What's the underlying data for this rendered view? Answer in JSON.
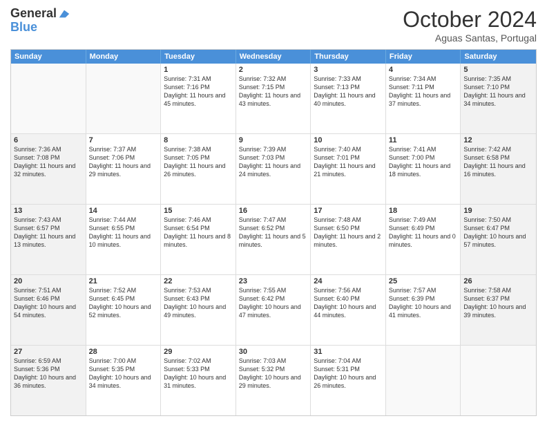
{
  "header": {
    "logo_line1": "General",
    "logo_line2": "Blue",
    "month_title": "October 2024",
    "location": "Aguas Santas, Portugal"
  },
  "days_of_week": [
    "Sunday",
    "Monday",
    "Tuesday",
    "Wednesday",
    "Thursday",
    "Friday",
    "Saturday"
  ],
  "rows": [
    [
      {
        "day": "",
        "text": "",
        "shade": false,
        "empty": true
      },
      {
        "day": "",
        "text": "",
        "shade": false,
        "empty": true
      },
      {
        "day": "1",
        "text": "Sunrise: 7:31 AM\nSunset: 7:16 PM\nDaylight: 11 hours and 45 minutes.",
        "shade": false,
        "empty": false
      },
      {
        "day": "2",
        "text": "Sunrise: 7:32 AM\nSunset: 7:15 PM\nDaylight: 11 hours and 43 minutes.",
        "shade": false,
        "empty": false
      },
      {
        "day": "3",
        "text": "Sunrise: 7:33 AM\nSunset: 7:13 PM\nDaylight: 11 hours and 40 minutes.",
        "shade": false,
        "empty": false
      },
      {
        "day": "4",
        "text": "Sunrise: 7:34 AM\nSunset: 7:11 PM\nDaylight: 11 hours and 37 minutes.",
        "shade": false,
        "empty": false
      },
      {
        "day": "5",
        "text": "Sunrise: 7:35 AM\nSunset: 7:10 PM\nDaylight: 11 hours and 34 minutes.",
        "shade": true,
        "empty": false
      }
    ],
    [
      {
        "day": "6",
        "text": "Sunrise: 7:36 AM\nSunset: 7:08 PM\nDaylight: 11 hours and 32 minutes.",
        "shade": true,
        "empty": false
      },
      {
        "day": "7",
        "text": "Sunrise: 7:37 AM\nSunset: 7:06 PM\nDaylight: 11 hours and 29 minutes.",
        "shade": false,
        "empty": false
      },
      {
        "day": "8",
        "text": "Sunrise: 7:38 AM\nSunset: 7:05 PM\nDaylight: 11 hours and 26 minutes.",
        "shade": false,
        "empty": false
      },
      {
        "day": "9",
        "text": "Sunrise: 7:39 AM\nSunset: 7:03 PM\nDaylight: 11 hours and 24 minutes.",
        "shade": false,
        "empty": false
      },
      {
        "day": "10",
        "text": "Sunrise: 7:40 AM\nSunset: 7:01 PM\nDaylight: 11 hours and 21 minutes.",
        "shade": false,
        "empty": false
      },
      {
        "day": "11",
        "text": "Sunrise: 7:41 AM\nSunset: 7:00 PM\nDaylight: 11 hours and 18 minutes.",
        "shade": false,
        "empty": false
      },
      {
        "day": "12",
        "text": "Sunrise: 7:42 AM\nSunset: 6:58 PM\nDaylight: 11 hours and 16 minutes.",
        "shade": true,
        "empty": false
      }
    ],
    [
      {
        "day": "13",
        "text": "Sunrise: 7:43 AM\nSunset: 6:57 PM\nDaylight: 11 hours and 13 minutes.",
        "shade": true,
        "empty": false
      },
      {
        "day": "14",
        "text": "Sunrise: 7:44 AM\nSunset: 6:55 PM\nDaylight: 11 hours and 10 minutes.",
        "shade": false,
        "empty": false
      },
      {
        "day": "15",
        "text": "Sunrise: 7:46 AM\nSunset: 6:54 PM\nDaylight: 11 hours and 8 minutes.",
        "shade": false,
        "empty": false
      },
      {
        "day": "16",
        "text": "Sunrise: 7:47 AM\nSunset: 6:52 PM\nDaylight: 11 hours and 5 minutes.",
        "shade": false,
        "empty": false
      },
      {
        "day": "17",
        "text": "Sunrise: 7:48 AM\nSunset: 6:50 PM\nDaylight: 11 hours and 2 minutes.",
        "shade": false,
        "empty": false
      },
      {
        "day": "18",
        "text": "Sunrise: 7:49 AM\nSunset: 6:49 PM\nDaylight: 11 hours and 0 minutes.",
        "shade": false,
        "empty": false
      },
      {
        "day": "19",
        "text": "Sunrise: 7:50 AM\nSunset: 6:47 PM\nDaylight: 10 hours and 57 minutes.",
        "shade": true,
        "empty": false
      }
    ],
    [
      {
        "day": "20",
        "text": "Sunrise: 7:51 AM\nSunset: 6:46 PM\nDaylight: 10 hours and 54 minutes.",
        "shade": true,
        "empty": false
      },
      {
        "day": "21",
        "text": "Sunrise: 7:52 AM\nSunset: 6:45 PM\nDaylight: 10 hours and 52 minutes.",
        "shade": false,
        "empty": false
      },
      {
        "day": "22",
        "text": "Sunrise: 7:53 AM\nSunset: 6:43 PM\nDaylight: 10 hours and 49 minutes.",
        "shade": false,
        "empty": false
      },
      {
        "day": "23",
        "text": "Sunrise: 7:55 AM\nSunset: 6:42 PM\nDaylight: 10 hours and 47 minutes.",
        "shade": false,
        "empty": false
      },
      {
        "day": "24",
        "text": "Sunrise: 7:56 AM\nSunset: 6:40 PM\nDaylight: 10 hours and 44 minutes.",
        "shade": false,
        "empty": false
      },
      {
        "day": "25",
        "text": "Sunrise: 7:57 AM\nSunset: 6:39 PM\nDaylight: 10 hours and 41 minutes.",
        "shade": false,
        "empty": false
      },
      {
        "day": "26",
        "text": "Sunrise: 7:58 AM\nSunset: 6:37 PM\nDaylight: 10 hours and 39 minutes.",
        "shade": true,
        "empty": false
      }
    ],
    [
      {
        "day": "27",
        "text": "Sunrise: 6:59 AM\nSunset: 5:36 PM\nDaylight: 10 hours and 36 minutes.",
        "shade": true,
        "empty": false
      },
      {
        "day": "28",
        "text": "Sunrise: 7:00 AM\nSunset: 5:35 PM\nDaylight: 10 hours and 34 minutes.",
        "shade": false,
        "empty": false
      },
      {
        "day": "29",
        "text": "Sunrise: 7:02 AM\nSunset: 5:33 PM\nDaylight: 10 hours and 31 minutes.",
        "shade": false,
        "empty": false
      },
      {
        "day": "30",
        "text": "Sunrise: 7:03 AM\nSunset: 5:32 PM\nDaylight: 10 hours and 29 minutes.",
        "shade": false,
        "empty": false
      },
      {
        "day": "31",
        "text": "Sunrise: 7:04 AM\nSunset: 5:31 PM\nDaylight: 10 hours and 26 minutes.",
        "shade": false,
        "empty": false
      },
      {
        "day": "",
        "text": "",
        "shade": false,
        "empty": true
      },
      {
        "day": "",
        "text": "",
        "shade": true,
        "empty": true
      }
    ]
  ]
}
